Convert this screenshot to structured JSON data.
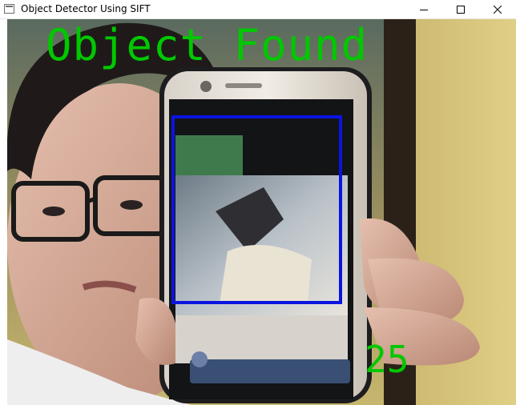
{
  "window": {
    "title": "Object Detector Using SIFT",
    "icon": "window-app-icon",
    "controls": [
      "minimize-icon",
      "maximize-icon",
      "close-icon"
    ]
  },
  "overlay": {
    "status_text": "Object Found",
    "count_text": "25",
    "text_color": "#00c800",
    "box_color": "#0a14e0"
  }
}
